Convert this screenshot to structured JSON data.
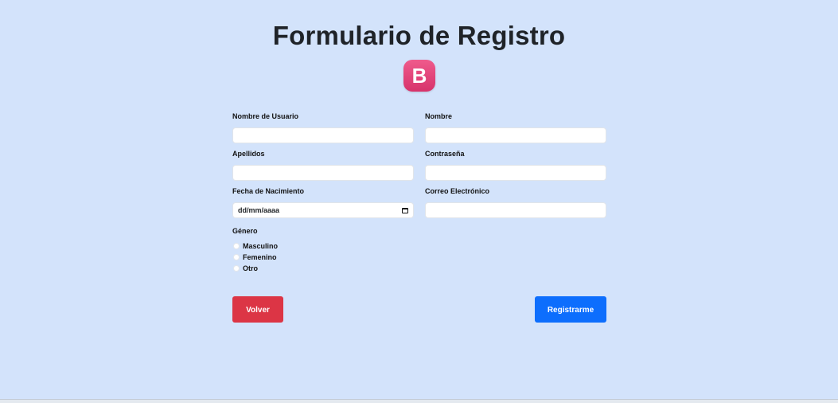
{
  "page": {
    "title": "Formulario de Registro",
    "logo_letter": "B",
    "logo_colors": [
      "#ef5b8c",
      "#d7336b"
    ],
    "background": "#d3e3fb"
  },
  "form": {
    "username": {
      "label": "Nombre de Usuario",
      "value": ""
    },
    "first_name": {
      "label": "Nombre",
      "value": ""
    },
    "last_name": {
      "label": "Apellidos",
      "value": ""
    },
    "password": {
      "label": "Contraseña",
      "value": ""
    },
    "birth_date": {
      "label": "Fecha de Nacimiento",
      "value": "dd/mm/aaaa"
    },
    "email": {
      "label": "Correo Electrónico",
      "value": ""
    },
    "gender": {
      "label": "Género",
      "options": [
        "Masculino",
        "Femenino",
        "Otro"
      ]
    }
  },
  "buttons": {
    "back": {
      "label": "Volver",
      "color": "#dc3545"
    },
    "register": {
      "label": "Registrarme",
      "color": "#0d6efd"
    }
  }
}
